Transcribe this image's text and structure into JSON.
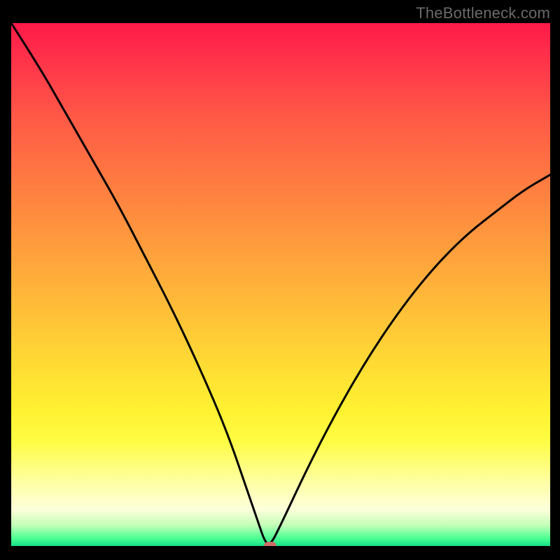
{
  "watermark": "TheBottleneck.com",
  "chart_data": {
    "type": "line",
    "title": "",
    "xlabel": "",
    "ylabel": "",
    "xlim": [
      0,
      100
    ],
    "ylim": [
      0,
      100
    ],
    "grid": false,
    "series": [
      {
        "name": "bottleneck-curve",
        "x": [
          0,
          5,
          10,
          15,
          20,
          25,
          30,
          35,
          40,
          44,
          46,
          47,
          48,
          50,
          55,
          60,
          65,
          70,
          75,
          80,
          85,
          90,
          95,
          100
        ],
        "y": [
          100,
          92,
          83,
          74,
          65,
          55,
          45,
          34,
          22,
          10,
          4,
          1,
          0,
          4,
          15,
          25,
          34,
          42,
          49,
          55,
          60,
          64,
          68,
          71
        ]
      }
    ],
    "marker": {
      "x": 48,
      "y": 0,
      "color": "#c97169"
    },
    "background_gradient": {
      "top": "#ff1a49",
      "middle": "#ffdd34",
      "bottom": "#14e089"
    }
  }
}
